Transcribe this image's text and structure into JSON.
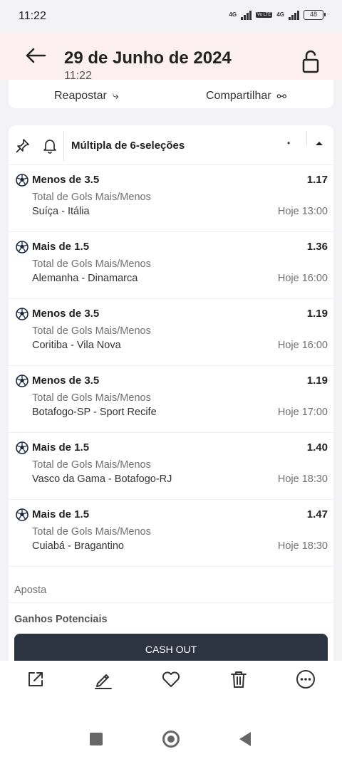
{
  "status_bar": {
    "time": "11:22",
    "network_1": "4G",
    "network_2": "4G",
    "volte": "Vo LTE",
    "battery": "48"
  },
  "header": {
    "title": "29 de Junho de 2024",
    "subtitle": "11:22"
  },
  "actions": {
    "repost_label": "Reapostar",
    "share_label": "Compartilhar"
  },
  "bet": {
    "type_label": "Múltipla de 6-seleções",
    "selections": [
      {
        "pick": "Menos de 3.5",
        "odd": "1.17",
        "market": "Total de Gols Mais/Menos",
        "match": "Suíça - Itália",
        "time": "Hoje 13:00"
      },
      {
        "pick": "Mais de 1.5",
        "odd": "1.36",
        "market": "Total de Gols Mais/Menos",
        "match": "Alemanha - Dinamarca",
        "time": "Hoje 16:00"
      },
      {
        "pick": "Menos de 3.5",
        "odd": "1.19",
        "market": "Total de Gols Mais/Menos",
        "match": "Coritiba - Vila Nova",
        "time": "Hoje 16:00"
      },
      {
        "pick": "Menos de 3.5",
        "odd": "1.19",
        "market": "Total de Gols Mais/Menos",
        "match": "Botafogo-SP - Sport Recife",
        "time": "Hoje 17:00"
      },
      {
        "pick": "Mais de 1.5",
        "odd": "1.40",
        "market": "Total de Gols Mais/Menos",
        "match": "Vasco da Gama - Botafogo-RJ",
        "time": "Hoje 18:30"
      },
      {
        "pick": "Mais de 1.5",
        "odd": "1.47",
        "market": "Total de Gols Mais/Menos",
        "match": "Cuiabá - Bragantino",
        "time": "Hoje 18:30"
      }
    ],
    "stake_label": "Aposta",
    "potential_label": "Ganhos Potenciais",
    "cashout_label": "CASH OUT"
  },
  "icons": {
    "back": "arrow-left-icon",
    "lock": "unlock-icon",
    "pin": "pin-icon",
    "bell": "bell-icon",
    "ball": "soccer-ball-icon",
    "share_out": "external-link-icon",
    "edit": "pencil-icon",
    "favorite": "heart-icon",
    "delete": "trash-icon",
    "more": "more-dots-icon"
  }
}
